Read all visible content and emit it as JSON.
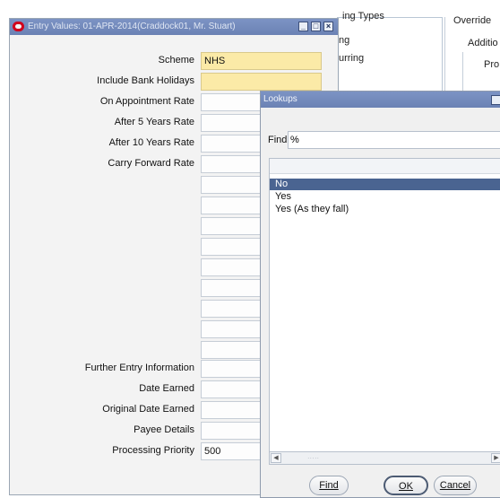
{
  "background_window": {
    "group_label": "ing Types",
    "override_label": "Override",
    "line1": "ng",
    "line2": "urring",
    "addition_label": "Additio",
    "pro_label": "Pro"
  },
  "entry_window": {
    "title": "Entry Values: 01-APR-2014(Craddock01, Mr. Stuart)",
    "controls": {
      "minimize": "_",
      "maximize": "□",
      "close": "×"
    },
    "fields": [
      {
        "label": "Scheme",
        "value": "NHS",
        "required": true
      },
      {
        "label": "Include Bank Holidays",
        "value": "",
        "required": true
      },
      {
        "label": "On Appointment Rate",
        "value": ""
      },
      {
        "label": "After 5 Years Rate",
        "value": ""
      },
      {
        "label": "After 10 Years Rate",
        "value": ""
      },
      {
        "label": "Carry Forward Rate",
        "value": ""
      },
      {
        "label": "",
        "value": ""
      },
      {
        "label": "",
        "value": ""
      },
      {
        "label": "",
        "value": ""
      },
      {
        "label": "",
        "value": ""
      },
      {
        "label": "",
        "value": ""
      },
      {
        "label": "",
        "value": ""
      },
      {
        "label": "",
        "value": ""
      },
      {
        "label": "",
        "value": ""
      },
      {
        "label": "",
        "value": ""
      },
      {
        "label": "Further Entry Information",
        "value": ""
      },
      {
        "label": "Date Earned",
        "value": ""
      },
      {
        "label": "Original Date Earned",
        "value": ""
      },
      {
        "label": "Payee Details",
        "value": ""
      },
      {
        "label": "Processing Priority",
        "value": "500"
      }
    ]
  },
  "lookups_dialog": {
    "title": "Lookups",
    "find_label": "Find",
    "find_value": "%",
    "items": [
      {
        "label": "No",
        "selected": true
      },
      {
        "label": "Yes",
        "selected": false
      },
      {
        "label": "Yes (As they fall)",
        "selected": false
      }
    ],
    "scroll_thumb": ".....",
    "buttons": {
      "find": "Find",
      "ok": "OK",
      "cancel": "Cancel"
    }
  },
  "colors": {
    "title_bar": "#6b82b4",
    "required_field": "#fbeaa7",
    "selection": "#4a6491",
    "oracle_red": "#d1001c"
  }
}
